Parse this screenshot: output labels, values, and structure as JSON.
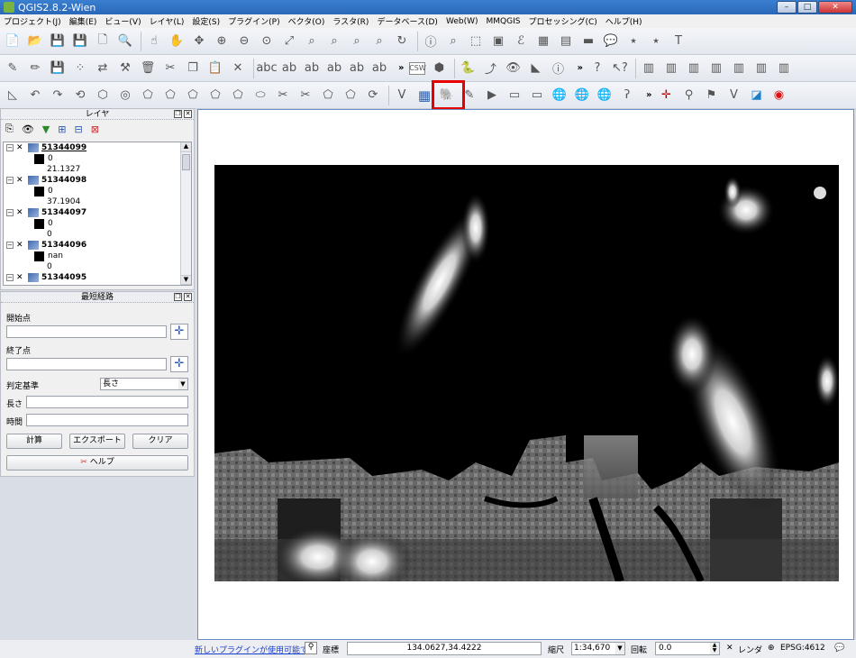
{
  "window": {
    "title": "QGIS2.8.2-Wien",
    "buttons": {
      "minimize": "–",
      "maximize": "□",
      "close": "✕"
    }
  },
  "menubar": [
    "プロジェクト(J)",
    "編集(E)",
    "ビュー(V)",
    "レイヤ(L)",
    "設定(S)",
    "プラグイン(P)",
    "ベクタ(O)",
    "ラスタ(R)",
    "データベース(D)",
    "Web(W)",
    "MMQGIS",
    "プロセッシング(C)",
    "ヘルプ(H)"
  ],
  "toolbar_labels": {
    "csw": "CSW",
    "more": "»"
  },
  "layers_panel": {
    "title": "レイヤ",
    "layers": [
      {
        "name": "51344099",
        "values": [
          "0",
          "21.1327"
        ]
      },
      {
        "name": "51344098",
        "values": [
          "0",
          "37.1904"
        ]
      },
      {
        "name": "51344097",
        "values": [
          "0",
          "0"
        ]
      },
      {
        "name": "51344096",
        "values": [
          "nan",
          "0"
        ]
      },
      {
        "name": "51344095",
        "values": [
          "",
          ""
        ]
      }
    ]
  },
  "route_panel": {
    "title": "最短経路",
    "start_label": "開始点",
    "end_label": "終了点",
    "criterion_label": "判定基準",
    "criterion_value": "長さ",
    "length_label": "長さ",
    "time_label": "時間",
    "calc_button": "計算",
    "export_button": "エクスポート",
    "clear_button": "クリア",
    "help_button": "ヘルプ"
  },
  "status_bar": {
    "plugin_notice": "新しいプラグインが使用可能です",
    "coord_label": "座標",
    "coord_value": "134.0627,34.4222",
    "scale_label": "縮尺",
    "scale_value": "1:34,670",
    "rotation_label": "回転",
    "rotation_value": "0.0",
    "render_label": "レンダ",
    "crs": "EPSG:4612"
  },
  "colors": {
    "highlight": "#e60000",
    "link": "#1a3fd0",
    "canvas_border": "#6a8ec6"
  }
}
